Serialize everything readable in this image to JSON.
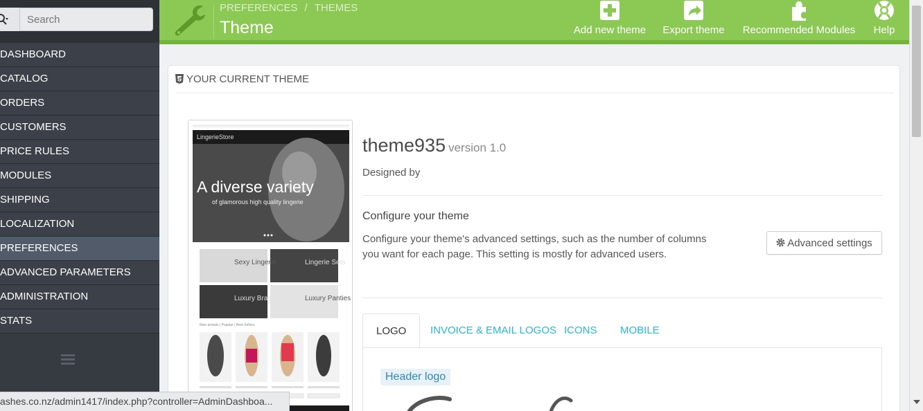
{
  "sidebar": {
    "search_placeholder": "Search",
    "items": [
      {
        "label": "DASHBOARD"
      },
      {
        "label": "CATALOG"
      },
      {
        "label": "ORDERS"
      },
      {
        "label": "CUSTOMERS"
      },
      {
        "label": "PRICE RULES"
      },
      {
        "label": "MODULES"
      },
      {
        "label": "SHIPPING"
      },
      {
        "label": "LOCALIZATION"
      },
      {
        "label": "PREFERENCES"
      },
      {
        "label": "ADVANCED PARAMETERS"
      },
      {
        "label": "ADMINISTRATION"
      },
      {
        "label": "STATS"
      }
    ],
    "active_index": 8
  },
  "status_bar": {
    "url": "ashes.co.nz/admin1417/index.php?controller=AdminDashboa..."
  },
  "header": {
    "breadcrumb": [
      "PREFERENCES",
      "THEMES"
    ],
    "title": "Theme",
    "toolbar": [
      {
        "label": "Add new theme",
        "icon": "plus-square-icon"
      },
      {
        "label": "Export theme",
        "icon": "share-icon"
      },
      {
        "label": "Recommended Modules",
        "icon": "puzzle-icon"
      },
      {
        "label": "Help",
        "icon": "lifebuoy-icon"
      }
    ],
    "colors": {
      "bar": "#8bc954",
      "bar_border": "#72b53a"
    }
  },
  "panel": {
    "heading": "YOUR CURRENT THEME",
    "theme_name": "theme935",
    "theme_version": "version 1.0",
    "designed_by": "Designed by",
    "configure_title": "Configure your theme",
    "configure_text": "Configure your theme's advanced settings, such as the number of columns you want for each page. This setting is mostly for advanced users.",
    "advanced_button": "Advanced settings",
    "tabs": [
      "LOGO",
      "INVOICE & EMAIL LOGOS",
      "ICONS",
      "MOBILE"
    ],
    "active_tab": 0,
    "header_logo_label": "Header logo"
  },
  "preview": {
    "store_name": "LingerieStore",
    "banner_line1": "A diverse variety",
    "banner_line2": "of glamorous high quality lingerie",
    "tiles": [
      "Sexy Lingerie",
      "Lingerie Sets",
      "Luxury Bras",
      "Luxury Panties"
    ],
    "section_label": "New arrivals | Popular | Best Sellers"
  }
}
